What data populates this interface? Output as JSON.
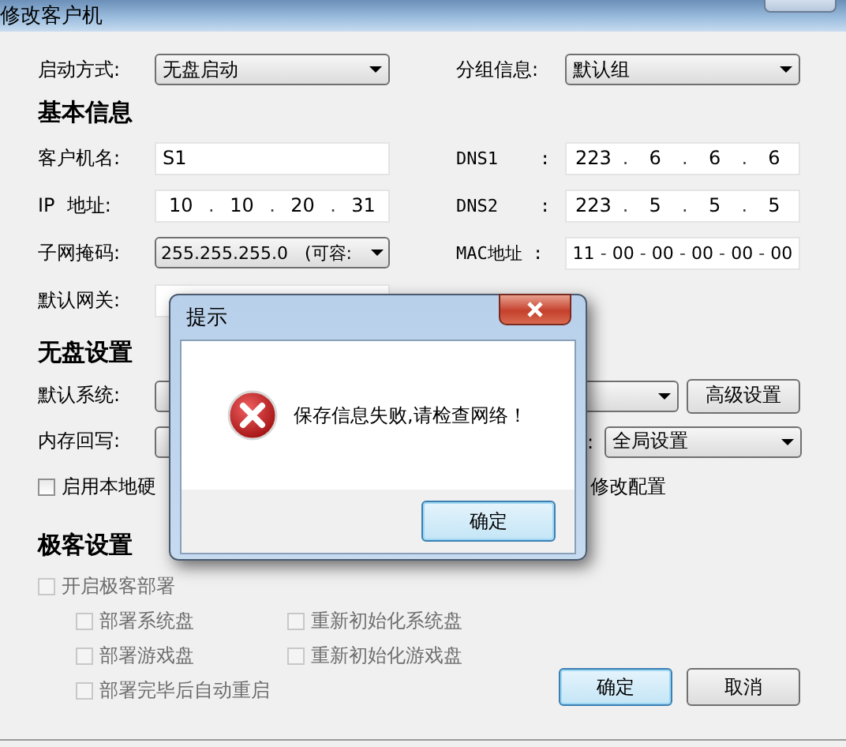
{
  "window": {
    "title": "修改客户机"
  },
  "boot": {
    "label": "启动方式:",
    "value": "无盘启动"
  },
  "group": {
    "label": "分组信息:",
    "value": "默认组"
  },
  "basic_info": {
    "heading": "基本信息",
    "left": [
      {
        "kind": "text",
        "label": "客户机名:",
        "value": "S1"
      },
      {
        "kind": "ip",
        "label": "IP  地址:",
        "separator": ".",
        "parts": [
          "10",
          "10",
          "20",
          "31"
        ]
      },
      {
        "kind": "select",
        "label": "子网掩码:",
        "value": "255.255.255.0   (可容:"
      },
      {
        "kind": "text",
        "label": "默认网关:"
      }
    ],
    "right": [
      {
        "kind": "ip",
        "label": "DNS1    :",
        "separator": ".",
        "parts": [
          "223",
          "6",
          "6",
          "6"
        ]
      },
      {
        "kind": "ip",
        "label": "DNS2    :",
        "separator": ".",
        "parts": [
          "223",
          "5",
          "5",
          "5"
        ]
      },
      {
        "kind": "mac",
        "label": "MAC地址 :",
        "separator": "-",
        "parts": [
          "11",
          "00",
          "00",
          "00",
          "00",
          "00"
        ]
      }
    ]
  },
  "diskless": {
    "heading": "无盘设置",
    "system_label": "默认系统:",
    "advanced_button": "高级设置",
    "writeback_label": "内存回写:",
    "colon": ":",
    "writeback_value": "全局设置",
    "local_disk": {
      "label": "启用本地硬",
      "checked": false
    },
    "modify_text": "修改配置"
  },
  "geek": {
    "heading": "极客设置",
    "master": {
      "label": "开启极客部署",
      "checked": false,
      "disabled": true
    },
    "options": [
      {
        "label": "部署系统盘",
        "checked": false,
        "disabled": true
      },
      {
        "label": "重新初始化系统盘",
        "checked": false,
        "disabled": true
      },
      {
        "label": "部署游戏盘",
        "checked": false,
        "disabled": true
      },
      {
        "label": "重新初始化游戏盘",
        "checked": false,
        "disabled": true
      },
      {
        "label": "部署完毕后自动重启",
        "checked": false,
        "disabled": true
      }
    ]
  },
  "buttons": [
    {
      "label": "确定",
      "default": true
    },
    {
      "label": "取消",
      "default": false
    }
  ],
  "dialog": {
    "title": "提示",
    "message": "保存信息失败,请检查网络！",
    "button": "确定"
  }
}
